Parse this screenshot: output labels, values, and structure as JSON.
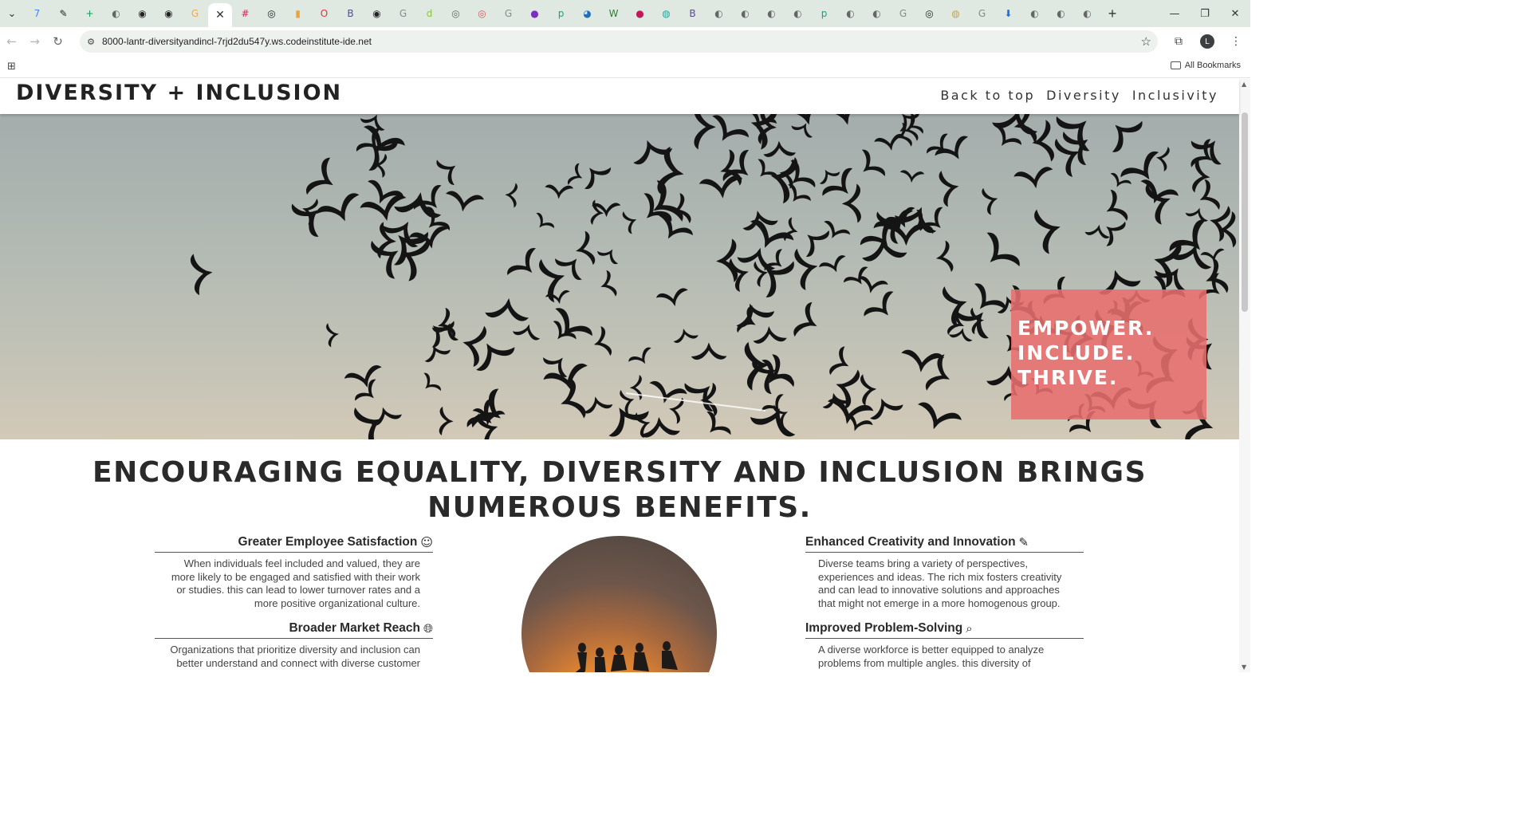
{
  "browser": {
    "tab_icons": [
      {
        "name": "chevron-down-icon",
        "color": "#444444",
        "glyph": "⌄"
      },
      {
        "name": "calendar-icon",
        "color": "#4285f4",
        "glyph": "7"
      },
      {
        "name": "scribble-icon",
        "color": "#222222",
        "glyph": "✎"
      },
      {
        "name": "sheets-icon",
        "color": "#0f9d58",
        "glyph": "+"
      },
      {
        "name": "globe-icon",
        "color": "#666666",
        "glyph": "◐"
      },
      {
        "name": "github-icon",
        "color": "#222222",
        "glyph": "◉"
      },
      {
        "name": "github-icon",
        "color": "#222222",
        "glyph": "◉"
      },
      {
        "name": "google-icon",
        "color": "#f4a742",
        "glyph": "G"
      }
    ],
    "tab_icons_after": [
      {
        "name": "slack-icon",
        "color": "#e01e5a",
        "glyph": "#"
      },
      {
        "name": "openai-icon",
        "color": "#222222",
        "glyph": "◎"
      },
      {
        "name": "bars-icon",
        "color": "#e8a33d",
        "glyph": "▮"
      },
      {
        "name": "opera-icon",
        "color": "#e2342d",
        "glyph": "O"
      },
      {
        "name": "b-icon",
        "color": "#5b4a8a",
        "glyph": "B"
      },
      {
        "name": "github-icon",
        "color": "#222222",
        "glyph": "◉"
      },
      {
        "name": "google-icon",
        "color": "#8a8a8a",
        "glyph": "G"
      },
      {
        "name": "doc-icon",
        "color": "#8bc34a",
        "glyph": "d"
      },
      {
        "name": "target-icon",
        "color": "#666666",
        "glyph": "◎"
      },
      {
        "name": "ring-icon",
        "color": "#d05a5a",
        "glyph": "◎"
      },
      {
        "name": "google-icon",
        "color": "#8a8a8a",
        "glyph": "G"
      },
      {
        "name": "purple-dot-icon",
        "color": "#7b2fbf",
        "glyph": "●"
      },
      {
        "name": "p-icon",
        "color": "#16a085",
        "glyph": "p"
      },
      {
        "name": "earth-icon",
        "color": "#1f6fbf",
        "glyph": "◕"
      },
      {
        "name": "w-icon",
        "color": "#2e7d32",
        "glyph": "W"
      },
      {
        "name": "rose-icon",
        "color": "#c2185b",
        "glyph": "●"
      },
      {
        "name": "palette-icon",
        "color": "#26a69a",
        "glyph": "◍"
      },
      {
        "name": "b-icon",
        "color": "#5b4a8a",
        "glyph": "B"
      },
      {
        "name": "globe-icon",
        "color": "#666666",
        "glyph": "◐"
      },
      {
        "name": "globe-icon",
        "color": "#666666",
        "glyph": "◐"
      },
      {
        "name": "globe-icon",
        "color": "#666666",
        "glyph": "◐"
      },
      {
        "name": "globe-icon",
        "color": "#666666",
        "glyph": "◐"
      },
      {
        "name": "p-icon",
        "color": "#16a085",
        "glyph": "p"
      },
      {
        "name": "globe-icon",
        "color": "#666666",
        "glyph": "◐"
      },
      {
        "name": "globe-icon",
        "color": "#666666",
        "glyph": "◐"
      },
      {
        "name": "google-icon",
        "color": "#8a8a8a",
        "glyph": "G"
      },
      {
        "name": "openai-icon",
        "color": "#222222",
        "glyph": "◎"
      },
      {
        "name": "emblem-icon",
        "color": "#c9a24a",
        "glyph": "◍"
      },
      {
        "name": "google-icon",
        "color": "#8a8a8a",
        "glyph": "G"
      },
      {
        "name": "download-icon",
        "color": "#1a73e8",
        "glyph": "⬇"
      },
      {
        "name": "globe-icon",
        "color": "#666666",
        "glyph": "◐"
      },
      {
        "name": "globe-icon",
        "color": "#666666",
        "glyph": "◐"
      },
      {
        "name": "globe-icon",
        "color": "#666666",
        "glyph": "◐"
      }
    ],
    "url": "8000-lantr-diversityandincl-7rjd2du547y.ws.codeinstitute-ide.net",
    "all_bookmarks": "All Bookmarks",
    "profile_initial": "L"
  },
  "site": {
    "brand": "DIVERSITY + INCLUSION",
    "nav": [
      "Back to top",
      "Diversity",
      "Inclusivity"
    ],
    "hero_tagline": [
      "EMPOWER.",
      "INCLUDE.",
      "THRIVE."
    ],
    "headline_line1": "ENCOURAGING EQUALITY, DIVERSITY AND INCLUSION BRINGS",
    "headline_line2": "NUMEROUS BENEFITS.",
    "benefits": [
      {
        "title": "Greater Employee Satisfaction",
        "icon": "smile-icon",
        "text": "When individuals feel included and valued, they are more likely to be engaged and satisfied with their work or studies. this can lead to lower turnover rates and a more positive organizational culture."
      },
      {
        "title": "Broader Market Reach",
        "icon": "globe-icon",
        "text": "Organizations that prioritize diversity and inclusion can better understand and connect with diverse customer"
      },
      {
        "title": "Enhanced Creativity and Innovation",
        "icon": "pencil-icon",
        "text": "Diverse teams bring a variety of perspectives, experiences and ideas. The rich mix fosters creativity and can lead to innovative solutions and approaches that might not emerge in a more homogenous group."
      },
      {
        "title": "Improved Problem-Solving",
        "icon": "search-icon",
        "text": "A diverse workforce is better equipped to analyze problems from multiple angles. this diversity of"
      }
    ]
  },
  "colors": {
    "tabstrip": "#dfe9e2",
    "hero_box": "#e86e6e",
    "text_dark": "#2a2a2a"
  }
}
